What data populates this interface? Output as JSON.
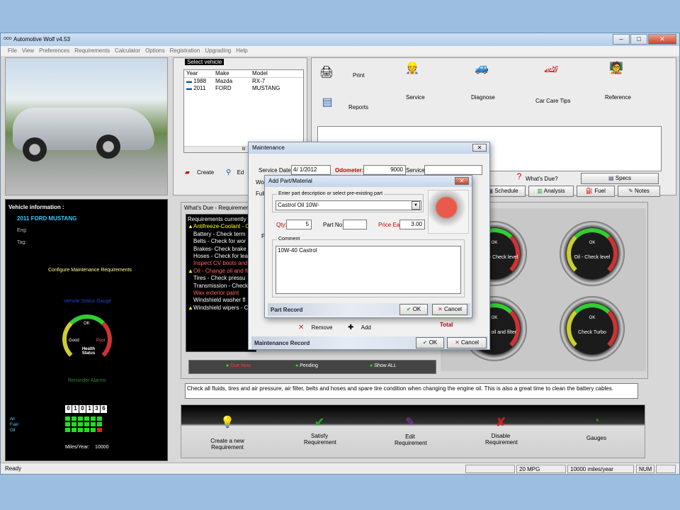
{
  "window": {
    "title": "Automotive Wolf v4.53"
  },
  "menu": [
    "File",
    "View",
    "Preferences",
    "Requirements",
    "Calculator",
    "Options",
    "Registration",
    "Upgrading",
    "Help"
  ],
  "vehicles": {
    "group_label": "Select vehicle",
    "columns": [
      "Year",
      "Make",
      "Model"
    ],
    "rows": [
      {
        "year": "1988",
        "make": "Mazda",
        "model": "RX-7"
      },
      {
        "year": "2011",
        "make": "FORD",
        "model": "MUSTANG"
      }
    ],
    "scroll_marker": "III",
    "create_label": "Create",
    "edit_label": "Ed"
  },
  "toolbar": {
    "print": "Print",
    "reports": "Reports",
    "service": "Service",
    "diagnose": "Diagnose",
    "car_care": "Car Care Tips",
    "reference": "Reference",
    "whats_due": "What's Due?",
    "specs": "Specs",
    "schedule": "Schedule",
    "analysis": "Analysis",
    "fuel": "Fuel",
    "notes": "Notes"
  },
  "vehicle_info": {
    "header": "Vehicle information :",
    "name": "2011 FORD MUSTANG",
    "eng_label": "Eng:",
    "tag_label": "Tag:",
    "configure": "Configure Maintenance Requirements",
    "status_gauge": "Vehicle Status Gauge",
    "gauge_ok": "OK",
    "gauge_good": "Good",
    "gauge_poor": "Poor",
    "gauge_center": "Health Status",
    "reminder": "Reminder Alarms",
    "odometer": [
      "0",
      "1",
      "0",
      "1",
      "3",
      "6"
    ],
    "alarm_labels": [
      "Air",
      "Fuel",
      "Oil"
    ],
    "miles_year_label": "Miles/Year:",
    "miles_year_value": "10000"
  },
  "whats_due": {
    "title": "What's Due - Requirements list",
    "list_header": "Requirements currently",
    "items": [
      {
        "text": "Antifreeze-Coolant - C",
        "color": "#ffff00",
        "flag": true
      },
      {
        "text": "Battery - Check term",
        "color": "#ffffff",
        "flag": false
      },
      {
        "text": "Belts - Check for wor",
        "color": "#ffffff",
        "flag": false
      },
      {
        "text": "Brakes- Check brake",
        "color": "#ffffff",
        "flag": false
      },
      {
        "text": "Hoses - Check for lea",
        "color": "#ffffff",
        "flag": false
      },
      {
        "text": "Inspect CV boots and",
        "color": "#ff6666",
        "flag": false
      },
      {
        "text": "Oil - Change oil and fi",
        "color": "#ff6666",
        "flag": true
      },
      {
        "text": "Tires - Check pressu",
        "color": "#ffffff",
        "flag": false
      },
      {
        "text": "Transmission - Check",
        "color": "#ffffff",
        "flag": false
      },
      {
        "text": "Wax exterior paint",
        "color": "#ff6666",
        "flag": false
      },
      {
        "text": "Windshield washer fl",
        "color": "#ffffff",
        "flag": false
      },
      {
        "text": "Windshield wipers - C",
        "color": "#ffffff",
        "flag": true
      }
    ],
    "filter_due": "Due Now",
    "filter_pending": "Pending",
    "filter_all": "Show ALL"
  },
  "gauges": [
    {
      "label": "Coolant - Check level",
      "ok": "OK"
    },
    {
      "label": "Oil - Check level",
      "ok": "OK"
    },
    {
      "label": "Change oil and filter",
      "ok": "OK"
    },
    {
      "label": "Check Turbo",
      "ok": "OK"
    }
  ],
  "description": "Check all fluids, tires and air pressure, air filter, belts and hoses and spare tire condition when changing the engine oil. This is also a great time to clean the battery cables.",
  "bottom_actions": {
    "create": "Create a new Requirement",
    "satisfy": "Satisfy Requirement",
    "edit": "Edit Requirement",
    "disable": "Disable Requirement",
    "gauges": "Gauges"
  },
  "maintenance": {
    "title": "Maintenance",
    "service_date_label": "Service Date :",
    "service_date": "4/ 1/2012",
    "odometer_label": "Odometer:",
    "odometer": "9000",
    "serviced_by_label": "Serviced by:",
    "work_label": "Wo",
    "full_label": "Full",
    "p_label": "P",
    "total_label": "Total",
    "remove": "Remove",
    "add": "Add",
    "footer": "Maintenance Record",
    "ok": "OK",
    "cancel": "Cancel"
  },
  "add_part": {
    "title": "Add Part/Material",
    "desc_legend": "Enter part description or select pre-existing part",
    "desc_value": "Castrol Oil 10W-",
    "qty_label": "Qty:",
    "qty": "5",
    "part_no_label": "Part No:",
    "price_label": "Price Ea:",
    "price": "3.00",
    "comment_legend": "Comment",
    "comment": "10W-40 Castrol",
    "footer": "Part Record",
    "ok": "OK",
    "cancel": "Cancel"
  },
  "status": {
    "ready": "Ready",
    "mpg": "20 MPG",
    "miles": "10000 miles/year",
    "num": "NUM"
  }
}
